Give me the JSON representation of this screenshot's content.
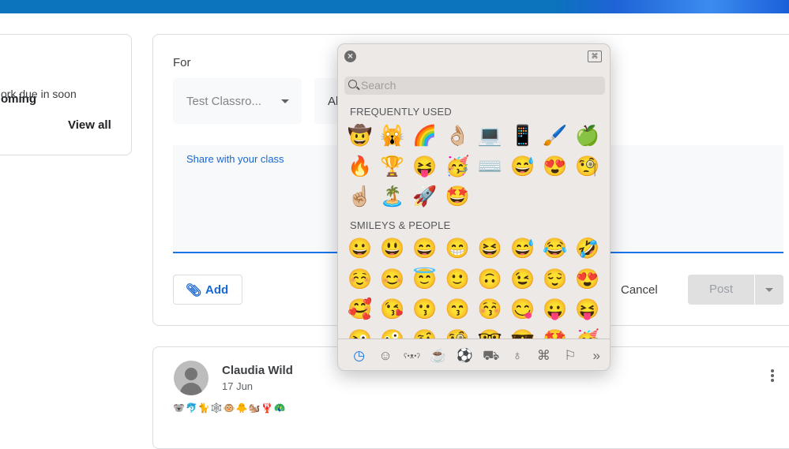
{
  "upcoming": {
    "title": "oming",
    "subtitle": "ork due in soon",
    "view_all": "View all"
  },
  "composer": {
    "for_label": "For",
    "class_select": "Test Classro...",
    "students_select": "Al",
    "textarea_placeholder": "Share with your class",
    "add_label": "Add",
    "cancel_label": "Cancel",
    "post_label": "Post",
    "accent": "#1967d2"
  },
  "post": {
    "author": "Claudia Wild",
    "date": "17 Jun",
    "content": "🐨🐬🐈🕸️🐵🐥🐿️🦞🦚"
  },
  "emoji_picker": {
    "search_placeholder": "Search",
    "frequently_used_label": "FREQUENTLY USED",
    "frequently_used": [
      "🤠",
      "🙀",
      "🌈",
      "👌🏼",
      "💻",
      "📱",
      "🖌️",
      "🍏",
      "🔥",
      "🏆",
      "😝",
      "🥳",
      "⌨️",
      "😅",
      "😍",
      "🧐",
      "☝🏼",
      "🏝️",
      "🚀",
      "🤩"
    ],
    "smileys_label": "SMILEYS & PEOPLE",
    "smileys": [
      "😀",
      "😃",
      "😄",
      "😁",
      "😆",
      "😅",
      "😂",
      "🤣",
      "☺️",
      "😊",
      "😇",
      "🙂",
      "🙃",
      "😉",
      "😌",
      "😍",
      "🥰",
      "😘",
      "😗",
      "😙",
      "😚",
      "😋",
      "😛",
      "😝",
      "😜",
      "🤪",
      "🤨",
      "🧐",
      "🤓",
      "😎",
      "🤩",
      "🥳"
    ],
    "categories": [
      {
        "name": "recent",
        "glyph": "◷"
      },
      {
        "name": "smileys",
        "glyph": "☺"
      },
      {
        "name": "animals",
        "glyph": "ʕ•ᴥ•ʔ"
      },
      {
        "name": "food",
        "glyph": "☕"
      },
      {
        "name": "activity",
        "glyph": "⚽"
      },
      {
        "name": "travel",
        "glyph": "⛟"
      },
      {
        "name": "objects",
        "glyph": "♁"
      },
      {
        "name": "symbols",
        "glyph": "⌘"
      },
      {
        "name": "flags",
        "glyph": "⚐"
      },
      {
        "name": "more",
        "glyph": "»"
      }
    ]
  }
}
